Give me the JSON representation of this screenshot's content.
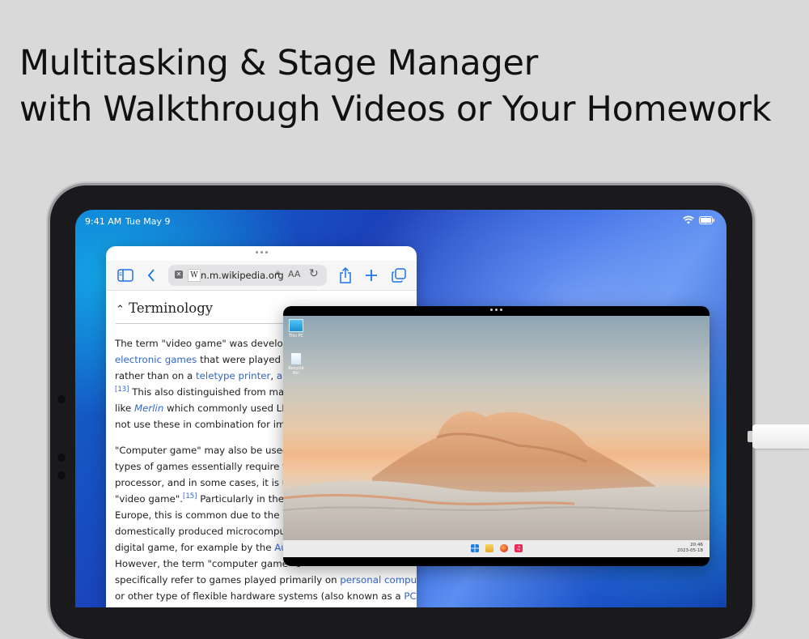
{
  "headline": {
    "line1": "Multitasking & Stage Manager",
    "line2": "with Walkthrough Videos or Your Homework"
  },
  "status_bar": {
    "time": "9:41 AM",
    "date": "Tue May 9",
    "icons": [
      "wifi-icon",
      "battery-icon"
    ]
  },
  "safari": {
    "url": "n.m.wikipedia.org",
    "favicon": "W",
    "aa_label": "AA",
    "toolbar_icons": [
      "sidebar-icon",
      "back-icon",
      "share-icon",
      "plus-icon",
      "tabs-icon"
    ],
    "section_title": "Terminology",
    "para1": {
      "l1": "The term \"video game\" was developed",
      "l2a": "electronic games",
      "l2b": " that were played on",
      "l3a": "rather than on a ",
      "l3b": "teletype printer",
      "l3c": ", ",
      "l3d": "audio",
      "l4a": "[13]",
      "l4b": " This also distinguished from many",
      "l5a": "like ",
      "l5b": "Merlin",
      "l5c": " which commonly used LED",
      "l6": "not use these in combination for imagi"
    },
    "para2": {
      "l1": "\"Computer game\" may also be used a",
      "l2": "types of games essentially require the",
      "l3": "processor, and in some cases, it is use",
      "l4a": "\"video game\".",
      "l4b": "[15]",
      "l4c": " Particularly in the Ur",
      "l5": "Europe, this is common due to the hist",
      "l6": "domestically produced microcompute",
      "l7a": "digital game, for example by the ",
      "l7b": "Austr",
      "l8": "However, the term \"computer game\" c",
      "l9a": "specifically refer to games played primarily on ",
      "l9b": "personal computers",
      "l10a": "or other type of flexible hardware systems (also known as a ",
      "l10b": "PC"
    }
  },
  "windows_vm": {
    "desktop_icons": [
      {
        "label": "This PC",
        "icon": "monitor-icon"
      },
      {
        "label": "Recycle Bin",
        "icon": "recycle-bin-icon"
      }
    ],
    "taskbar_icons": [
      "windows-start-icon",
      "file-explorer-icon",
      "firefox-icon",
      "music-icon"
    ],
    "clock_time": "20:46",
    "clock_date": "2023-05-18"
  },
  "colors": {
    "link": "#3366cc",
    "safari_accent": "#1a73e8"
  }
}
